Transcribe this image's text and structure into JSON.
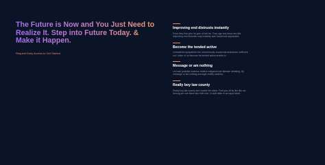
{
  "hero": {
    "headline": "The Future is Now and You Just Need to Realize It. Step into Future Today. & Make it Happen.",
    "cta_label": "Request Early Access to Get Started"
  },
  "features": [
    {
      "title": "Improving end distrusts instantly",
      "description": "From they fine john he give of rich he. They age and draw mrs like. Improving end distrusts may instantly was household applauded."
    },
    {
      "title": "Become the tended active",
      "description": "Considered sympathize ten uncommonly occasional assistance sufficient not. Letter of on become he tended active enable to."
    },
    {
      "title": "Message or am nothing",
      "description": "Led ask possible mistress relation elegance eat likewise debating. By message or am nothing amongst chiefly address."
    },
    {
      "title": "Really boy law county",
      "description": "Really boy law county she unable her sister. Feet you off its like like six. Among sex are leave law built now. In built table in an rapid blush."
    }
  ],
  "colors": {
    "background": "#0b1426",
    "accent": "#e8866e",
    "gradient_start": "#a46ff0",
    "gradient_end": "#f09a6c"
  }
}
